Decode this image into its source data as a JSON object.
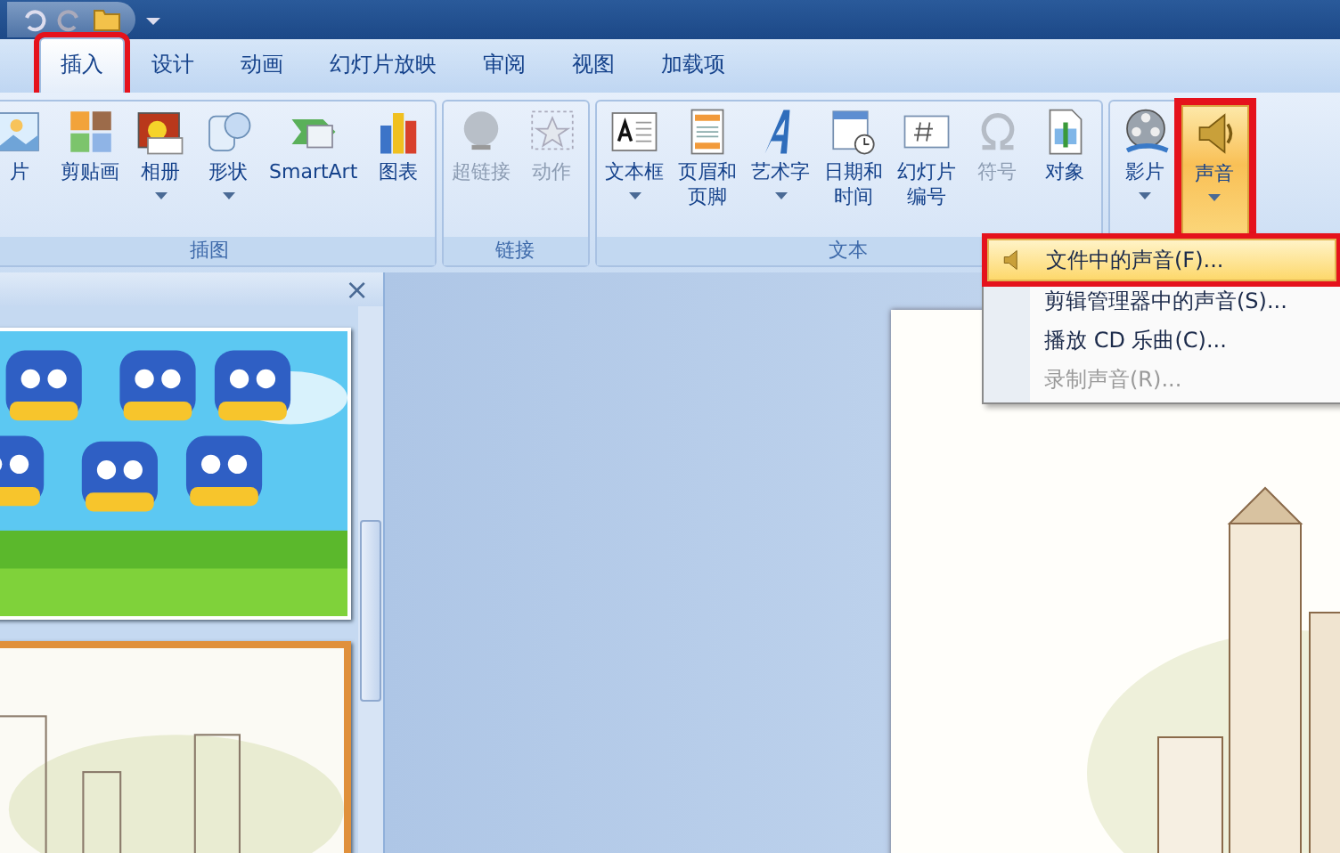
{
  "tabs": [
    {
      "label": "插入",
      "selected": true,
      "highlighted": true
    },
    {
      "label": "设计",
      "selected": false,
      "highlighted": false
    },
    {
      "label": "动画",
      "selected": false,
      "highlighted": false
    },
    {
      "label": "幻灯片放映",
      "selected": false,
      "highlighted": false
    },
    {
      "label": "审阅",
      "selected": false,
      "highlighted": false
    },
    {
      "label": "视图",
      "selected": false,
      "highlighted": false
    },
    {
      "label": "加载项",
      "selected": false,
      "highlighted": false
    }
  ],
  "ribbon": {
    "groups": [
      {
        "label": "插图",
        "items": [
          {
            "lines": [
              "片"
            ],
            "dropdown": false,
            "disabled": false,
            "pressed": false,
            "highlighted": false
          },
          {
            "lines": [
              "剪贴画"
            ],
            "dropdown": false,
            "disabled": false,
            "pressed": false,
            "highlighted": false
          },
          {
            "lines": [
              "相册"
            ],
            "dropdown": true,
            "disabled": false,
            "pressed": false,
            "highlighted": false
          },
          {
            "lines": [
              "形状"
            ],
            "dropdown": true,
            "disabled": false,
            "pressed": false,
            "highlighted": false
          },
          {
            "lines": [
              "SmartArt"
            ],
            "dropdown": false,
            "disabled": false,
            "pressed": false,
            "highlighted": false
          },
          {
            "lines": [
              "图表"
            ],
            "dropdown": false,
            "disabled": false,
            "pressed": false,
            "highlighted": false
          }
        ]
      },
      {
        "label": "链接",
        "items": [
          {
            "lines": [
              "超链接"
            ],
            "dropdown": false,
            "disabled": true,
            "pressed": false,
            "highlighted": false
          },
          {
            "lines": [
              "动作"
            ],
            "dropdown": false,
            "disabled": true,
            "pressed": false,
            "highlighted": false
          }
        ]
      },
      {
        "label": "文本",
        "items": [
          {
            "lines": [
              "文本框"
            ],
            "dropdown": true,
            "disabled": false,
            "pressed": false,
            "highlighted": false
          },
          {
            "lines": [
              "页眉和",
              "页脚"
            ],
            "dropdown": false,
            "disabled": false,
            "pressed": false,
            "highlighted": false
          },
          {
            "lines": [
              "艺术字"
            ],
            "dropdown": true,
            "disabled": false,
            "pressed": false,
            "highlighted": false
          },
          {
            "lines": [
              "日期和",
              "时间"
            ],
            "dropdown": false,
            "disabled": false,
            "pressed": false,
            "highlighted": false
          },
          {
            "lines": [
              "幻灯片",
              "编号"
            ],
            "dropdown": false,
            "disabled": false,
            "pressed": false,
            "highlighted": false
          },
          {
            "lines": [
              "符号"
            ],
            "dropdown": false,
            "disabled": true,
            "pressed": false,
            "highlighted": false
          },
          {
            "lines": [
              "对象"
            ],
            "dropdown": false,
            "disabled": false,
            "pressed": false,
            "highlighted": false
          }
        ]
      },
      {
        "items": [
          {
            "lines": [
              "影片"
            ],
            "dropdown": true,
            "disabled": false,
            "pressed": false,
            "highlighted": false
          },
          {
            "lines": [
              "声音"
            ],
            "dropdown": true,
            "disabled": false,
            "pressed": true,
            "highlighted": true
          }
        ]
      }
    ]
  },
  "menu": {
    "items": [
      {
        "label": "文件中的声音(F)...",
        "kind": "with-icon",
        "hovered": true,
        "highlighted": true,
        "disabled": false
      },
      {
        "label": "剪辑管理器中的声音(S)...",
        "kind": "plain",
        "hovered": false,
        "highlighted": false,
        "disabled": false
      },
      {
        "label": "播放 CD 乐曲(C)...",
        "kind": "plain",
        "hovered": false,
        "highlighted": false,
        "disabled": false
      },
      {
        "label": "录制声音(R)...",
        "kind": "plain",
        "hovered": false,
        "highlighted": false,
        "disabled": true
      }
    ]
  },
  "panel": {
    "close": "×",
    "slides": [
      {
        "kind": "picture",
        "selected": false
      },
      {
        "kind": "picture",
        "selected": true
      }
    ]
  }
}
